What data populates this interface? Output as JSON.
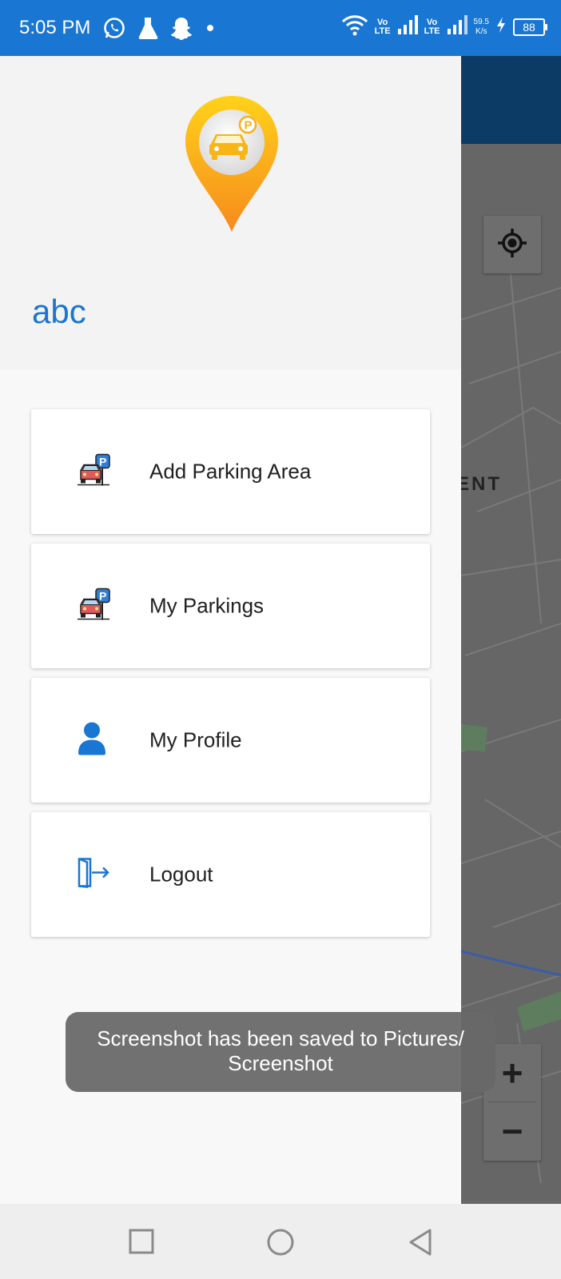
{
  "status_bar": {
    "time": "5:05 PM",
    "left_icons": [
      "whatsapp-icon",
      "flask-icon",
      "snapchat-icon",
      "dot-icon"
    ],
    "volte_1": "Vo\nLTE",
    "volte_2": "Vo\nLTE",
    "net_speed_value": "59.5",
    "net_speed_unit": "K/s",
    "battery": "88"
  },
  "drawer": {
    "username": "abc",
    "menu_items": [
      {
        "label": "Add Parking Area",
        "icon": "parking-car-icon"
      },
      {
        "label": "My Parkings",
        "icon": "parking-car-icon"
      },
      {
        "label": "My Profile",
        "icon": "user-icon"
      },
      {
        "label": "Logout",
        "icon": "logout-icon"
      }
    ]
  },
  "map": {
    "partial_label": "ENT",
    "zoom_in": "+",
    "zoom_out": "−"
  },
  "toast": {
    "message": "Screenshot has been saved to  Pictures/\nScreenshot"
  },
  "nav_bar": {
    "buttons": [
      "recents-icon",
      "home-icon",
      "back-icon"
    ]
  },
  "colors": {
    "status_bar": "#1976d2",
    "accent": "#1976d2",
    "app_bar_dark": "#0c3c65"
  }
}
